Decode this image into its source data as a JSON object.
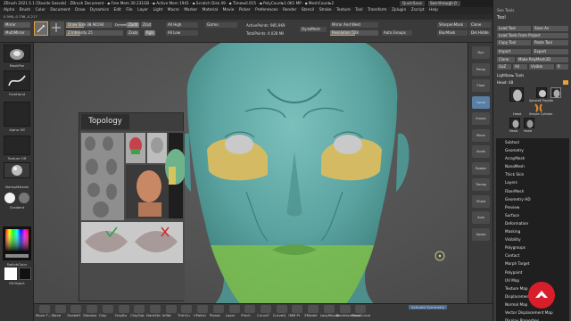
{
  "titlebar": {
    "text": "ZBrush 2021.5.1 [Davide Sasseb] · ZBrush Document · ▪ Free Mem 30.231GB · ▪ Active Mem 1941 · ▪ Scratch Disk 49 · ▪ Timer▸0.015 · ▪ PolyCount▸1.061 MP · ▪ MeshCount▸2",
    "quicksave": "QuickSave",
    "seethrough": "See-through 0",
    "menus_label": "Menus",
    "default_script": "DefaultZScript"
  },
  "menubar": {
    "items": [
      "Alpha",
      "Brush",
      "Color",
      "Document",
      "Draw",
      "Dynamics",
      "Edit",
      "File",
      "Layer",
      "Light",
      "Macro",
      "Marker",
      "Material",
      "Movie",
      "Picker",
      "Preferences",
      "Render",
      "Stencil",
      "Stroke",
      "Texture",
      "Tool",
      "Transform",
      "Zplugin",
      "Zscript",
      "Help"
    ]
  },
  "status_line": "0.598,-0.736,-0.217",
  "shelf": {
    "mirror": "Mirror",
    "multimirror": "MultiMirror",
    "draw_size_label": "Draw Size",
    "draw_size_value": "38.94194",
    "draw_size_fraction": 0.39,
    "dynamic": "Dynamic",
    "z_intensity_label": "Z Intensity",
    "z_intensity_value": "25",
    "z_intensity_fraction": 0.25,
    "zadd": "Zadd",
    "zsub": "Zsub",
    "zcut": "Zcut",
    "rgb": "Rgb",
    "all_high": "All High",
    "all_low": "All Low",
    "gizmo": "Gizmo",
    "active_points": "ActivePoints: 985,969",
    "total_points": "TotalPoints: 4.028 Mil",
    "dynamesh": "DynaMesh",
    "mirror_and_weld": "Mirror And Weld",
    "sharpen_mask": "SharpenMask",
    "blur_mask": "BlurMask",
    "resolution_label": "Resolution",
    "resolution_value": "528",
    "resolution_fraction": 0.52,
    "auto_groups": "Auto Groups",
    "clone": "Clone",
    "del_hidden": "Del Hidde"
  },
  "lefttray": {
    "brush_label": "MaskPen",
    "stroke_label": "FreeHand",
    "alpha_label": "Alpha Off",
    "texture_label": "Texture Off",
    "material_label": "StartupMaterial",
    "gradient_label": "Gradient",
    "switch_color": "SwitchColor",
    "fillobject": "FillObject"
  },
  "topology": {
    "title": "Topology"
  },
  "rightstrip": {
    "items": [
      "Dyn",
      "Persp",
      "Floor",
      "Local",
      "Frame",
      "Move",
      "Scale",
      "Rotate",
      "Transp",
      "Ghost",
      "Solo",
      "Xpose"
    ]
  },
  "palette": {
    "title": "Tool",
    "lightbox_tools": "Lightbox▸ Tools",
    "see_tools": "See Tools",
    "load_tool": "Load Tool",
    "save_as": "Save As",
    "load_from_project": "Load Tools From Project",
    "copy_tool": "Copy Tool",
    "paste_tool": "Paste Tool",
    "import": "Import",
    "export": "Export",
    "clone": "Clone",
    "make_polymesh": "Make PolyMesh3D",
    "goz": "GoZ",
    "all": "All",
    "visible": "Visible",
    "r_label": "R",
    "head_label": "Head: 48",
    "tool_names": [
      "Head",
      "SphereE PolyMe",
      "Simple Cylinder",
      "Head",
      "Head"
    ],
    "sections": [
      "Subtool",
      "Geometry",
      "ArrayMesh",
      "NanoMesh",
      "Thick Skin",
      "Layers",
      "FiberMesh",
      "Geometry HD",
      "Preview",
      "Surface",
      "Deformation",
      "Masking",
      "Visibility",
      "Polygroups",
      "Contact",
      "Morph Target",
      "Polypaint",
      "UV Map",
      "Texture Map",
      "Displacement Map",
      "Normal Map",
      "Vector Displacement Map",
      "Display Properties"
    ]
  },
  "bottombar": {
    "items": [
      "Move T...",
      "Move",
      "SnakeH",
      "Standar",
      "Clay",
      "ClayBu",
      "ClayTub",
      "DamStd",
      "Inflat",
      "TrimCu",
      "hPolish",
      "Planar",
      "Layer",
      "Pinch",
      "CurveT",
      "CurveQ",
      "IMM Pr",
      "ZModel",
      "LazyMouse",
      "BackfaceMask",
      "AccuCurve"
    ],
    "activate_symmetry": "Activate Symmetry"
  },
  "colors": {
    "face_skin": "#5aa3a0",
    "eye_band": "#d4bb63",
    "mouth_band": "#7fbf4a",
    "eye_ball": "#c9c9c9",
    "canvas_bg": "#545454",
    "accent_orange": "#e8a23a",
    "cursor_yellow": "#e6e08a",
    "logo_red": "#d81e2a"
  },
  "icons": [
    "brush-icon",
    "stroke-icon",
    "color-picker-icon",
    "lasso-icon",
    "cursor-crosshair-icon",
    "brand-logo-icon"
  ]
}
